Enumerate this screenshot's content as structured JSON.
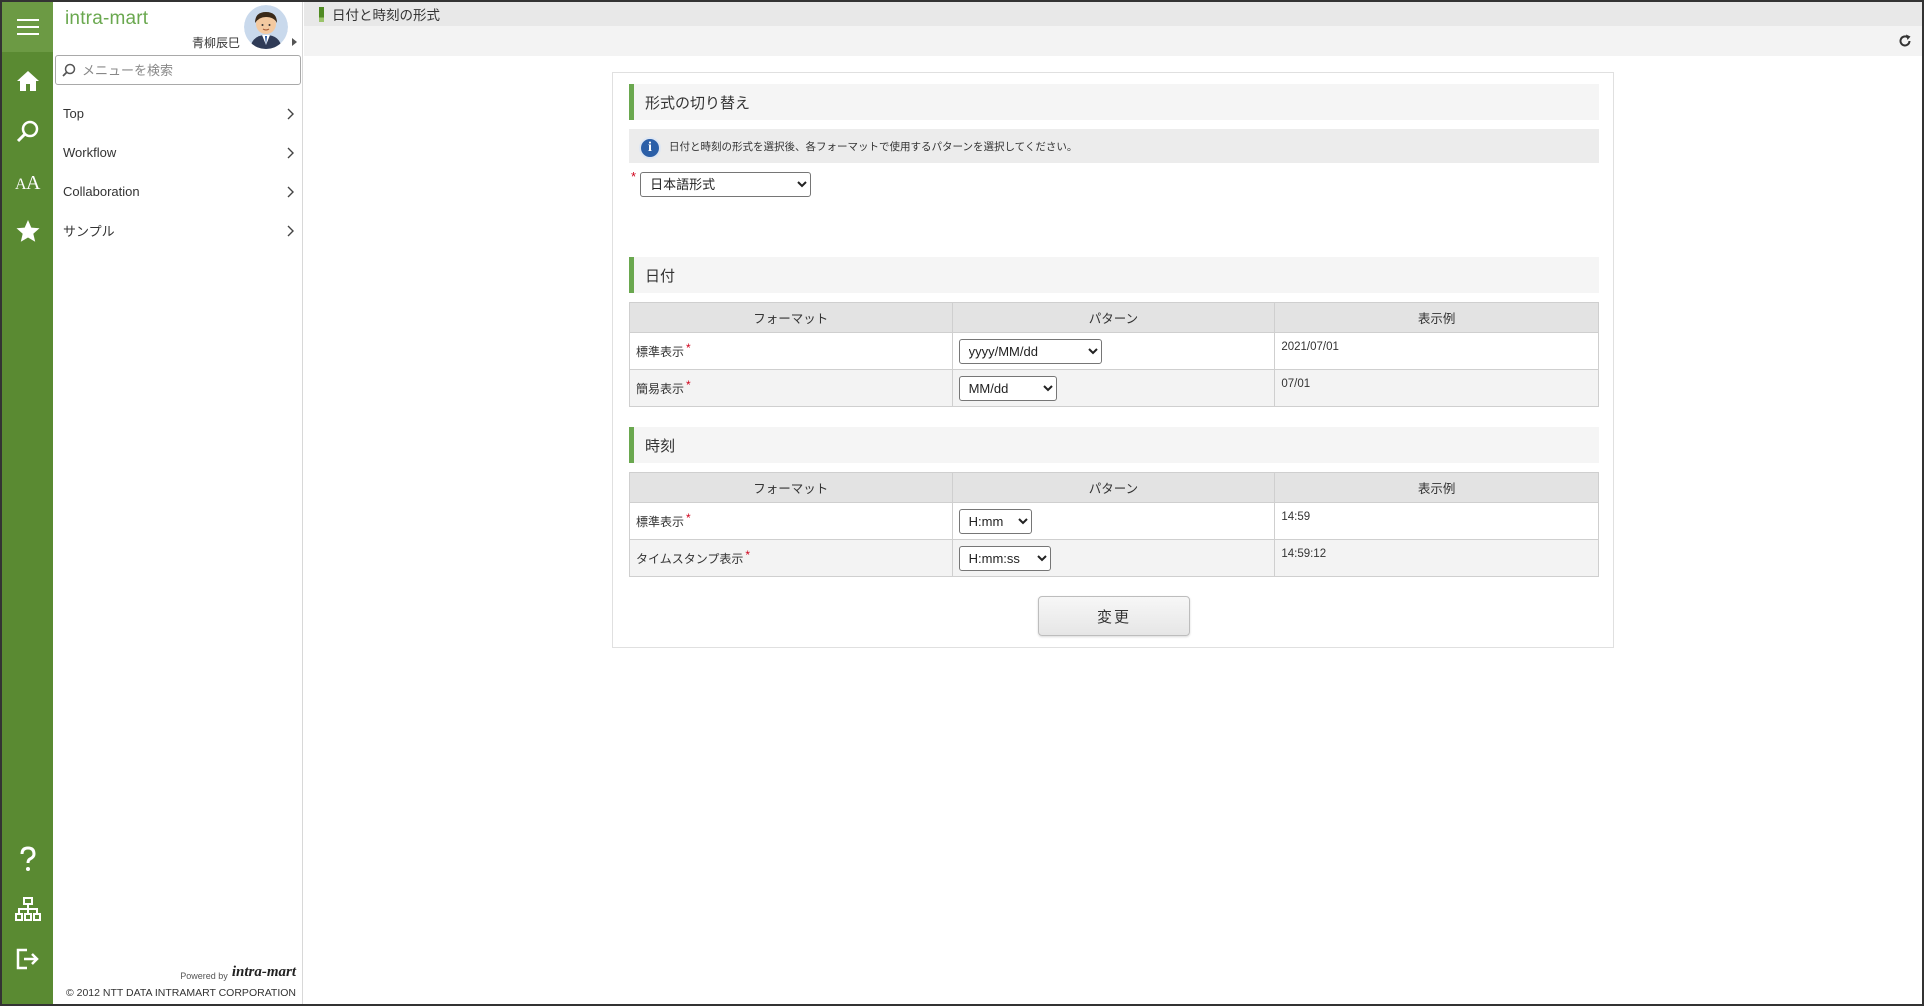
{
  "app": {
    "brand": "intra-mart",
    "user_name": "青柳辰巳",
    "page_title": "日付と時刻の形式"
  },
  "rail": {
    "icons": [
      "menu-icon",
      "home-icon",
      "search-icon",
      "font-size-icon",
      "star-icon",
      "help-icon",
      "sitemap-icon",
      "logout-icon"
    ],
    "color": "#5a8a32"
  },
  "sidebar": {
    "search_placeholder": "メニューを検索",
    "items": [
      {
        "label": "Top"
      },
      {
        "label": "Workflow"
      },
      {
        "label": "Collaboration"
      },
      {
        "label": "サンプル"
      }
    ],
    "powered_by": "Powered by",
    "logo_text": "intra-mart",
    "copyright": "© 2012 NTT DATA INTRAMART CORPORATION"
  },
  "main": {
    "switch_section": {
      "title": "形式の切り替え",
      "info": "日付と時刻の形式を選択後、各フォーマットで使用するパターンを選択してください。",
      "required_mark": "*",
      "selected_format": "日本語形式"
    },
    "date_section": {
      "title": "日付",
      "headers": [
        "フォーマット",
        "パターン",
        "表示例"
      ],
      "rows": [
        {
          "format": "標準表示",
          "pattern": "yyyy/MM/dd",
          "example": "2021/07/01"
        },
        {
          "format": "簡易表示",
          "pattern": "MM/dd",
          "example": "07/01"
        }
      ]
    },
    "time_section": {
      "title": "時刻",
      "headers": [
        "フォーマット",
        "パターン",
        "表示例"
      ],
      "rows": [
        {
          "format": "標準表示",
          "pattern": "H:mm",
          "example": "14:59"
        },
        {
          "format": "タイムスタンプ表示",
          "pattern": "H:mm:ss",
          "example": "14:59:12"
        }
      ]
    },
    "change_button": "変更"
  },
  "colors": {
    "accent_green": "#6aa84f",
    "required_red": "#d0021b",
    "info_blue": "#2b5fa8"
  }
}
